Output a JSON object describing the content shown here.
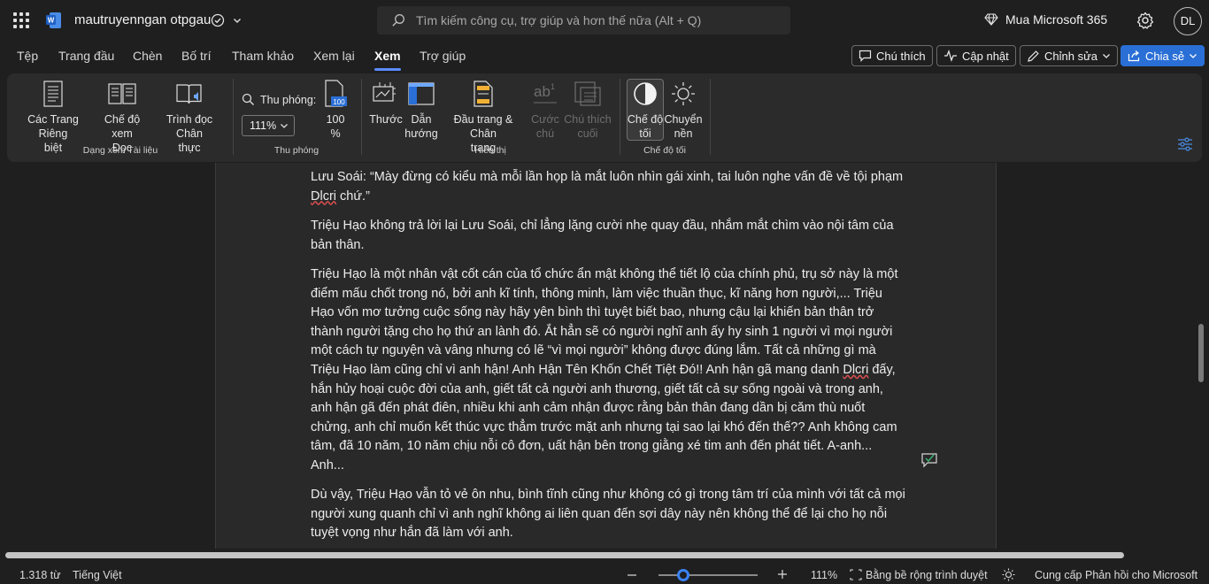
{
  "app": {
    "doc_title": "mautruyenngan otpgau",
    "search_placeholder": "Tìm kiếm công cụ, trợ giúp và hơn thế nữa (Alt + Q)",
    "buy_label": "Mua Microsoft 365",
    "avatar_initials": "DL"
  },
  "tabs": [
    "Tệp",
    "Trang đầu",
    "Chèn",
    "Bố trí",
    "Tham khảo",
    "Xem lại",
    "Xem",
    "Trợ giúp"
  ],
  "active_tab": "Xem",
  "right_buttons": {
    "comments": "Chú thích",
    "updates": "Cập nhật",
    "editing": "Chỉnh sửa",
    "share": "Chia sẻ"
  },
  "ribbon": {
    "views": {
      "immersive_line1": "Các Trang Riêng",
      "immersive_line2": "biệt",
      "read_line1": "Chế độ xem",
      "read_line2": "Đọc",
      "reader_line1": "Trình đọc Chân",
      "reader_line2": "thực",
      "group": "Dạng xem Tài liệu"
    },
    "zoom": {
      "label": "Thu phóng:",
      "value": "111%",
      "hundred_line1": "100",
      "hundred_line2": "%",
      "group": "Thu phóng"
    },
    "show": {
      "ruler": "Thước",
      "nav_line1": "Dẫn",
      "nav_line2": "hướng",
      "hf_line1": "Đầu trang & Chân",
      "hf_line2": "trang",
      "foot_line1": "Cước",
      "foot_line2": "chú",
      "end_line1": "Chú thích",
      "end_line2": "cuối",
      "group": "Hiển thị"
    },
    "dark": {
      "dark_line1": "Chế độ",
      "dark_line2": "tối",
      "switch_line1": "Chuyển",
      "switch_line2": "nền",
      "group": "Chế độ tối"
    }
  },
  "document": {
    "p1_a": "Lưu Soái: “Mày đừng có kiểu mà mỗi lần họp là mắt luôn nhìn gái xinh, tai luôn nghe vấn đề về tội phạm ",
    "p1_err": "Dlcri",
    "p1_b": " chứ.”",
    "p2": "Triệu Hạo không trả lời lại Lưu Soái, chỉ lẳng lặng cười nhẹ quay đầu, nhắm mắt chìm vào nội tâm của bản thân.",
    "p3_a": "Triệu Hạo là một nhân vật cốt cán của tổ chức ẩn mật không thể tiết lộ của chính phủ, trụ sở này là một điểm mấu chốt trong nó, bởi anh kĩ tính, thông minh, làm việc thuần thục, kĩ năng hơn người,... Triệu Hạo vốn mơ tưởng cuộc sống này hãy yên bình thì tuyệt biết bao, nhưng cậu lại khiến bản thân trở thành người tặng cho họ thứ an lành đó. Ắt hẳn sẽ có người nghĩ anh ấy hy sinh 1 người vì mọi người một cách tự nguyện và vâng nhưng có lẽ “vì mọi người” không được đúng lắm. Tất cả những gì mà Triệu Hạo làm cũng chỉ vì anh hận! Anh Hận Tên Khốn Chết Tiệt Đó!! Anh hận gã mang danh ",
    "p3_err": "Dlcri",
    "p3_b": " đấy, hắn hủy hoại cuộc đời của anh, giết tất cả người anh thương, giết tất cả sự sống ngoài và trong anh, anh hận gã đến phát điên, nhiều khi anh cảm nhận được rằng bản thân đang dần bị căm thù nuốt chửng, anh chỉ muốn kết thúc vực thẳm trước mặt anh nhưng tại sao lại khó đến thế?? Anh không cam tâm, đã 10 năm, 10 năm chịu nỗi cô đơn, uất hận bên trong giằng xé tim anh đến phát tiết. A-anh... Anh...",
    "p4": "Dù vậy, Triệu Hạo vẫn tỏ vẻ ôn nhu, bình tĩnh cũng như không có gì trong tâm trí của mình với tất cả mọi người xung quanh chỉ vì anh nghĩ không ai liên quan đến sợi dây này nên không thể để lại cho họ nỗi tuyệt vọng như hắn đã làm với anh."
  },
  "status": {
    "words": "1.318 từ",
    "language": "Tiếng Việt",
    "zoom": "111%",
    "fit_width": "Bằng bề rộng trình duyệt",
    "feedback": "Cung cấp Phản hồi cho Microsoft",
    "zoom_level": 0.25
  },
  "colors": {
    "accent": "#2a6fd6",
    "tab_underline": "#5b8cff",
    "page_bg": "#292929",
    "app_bg": "#1f1f1f"
  }
}
